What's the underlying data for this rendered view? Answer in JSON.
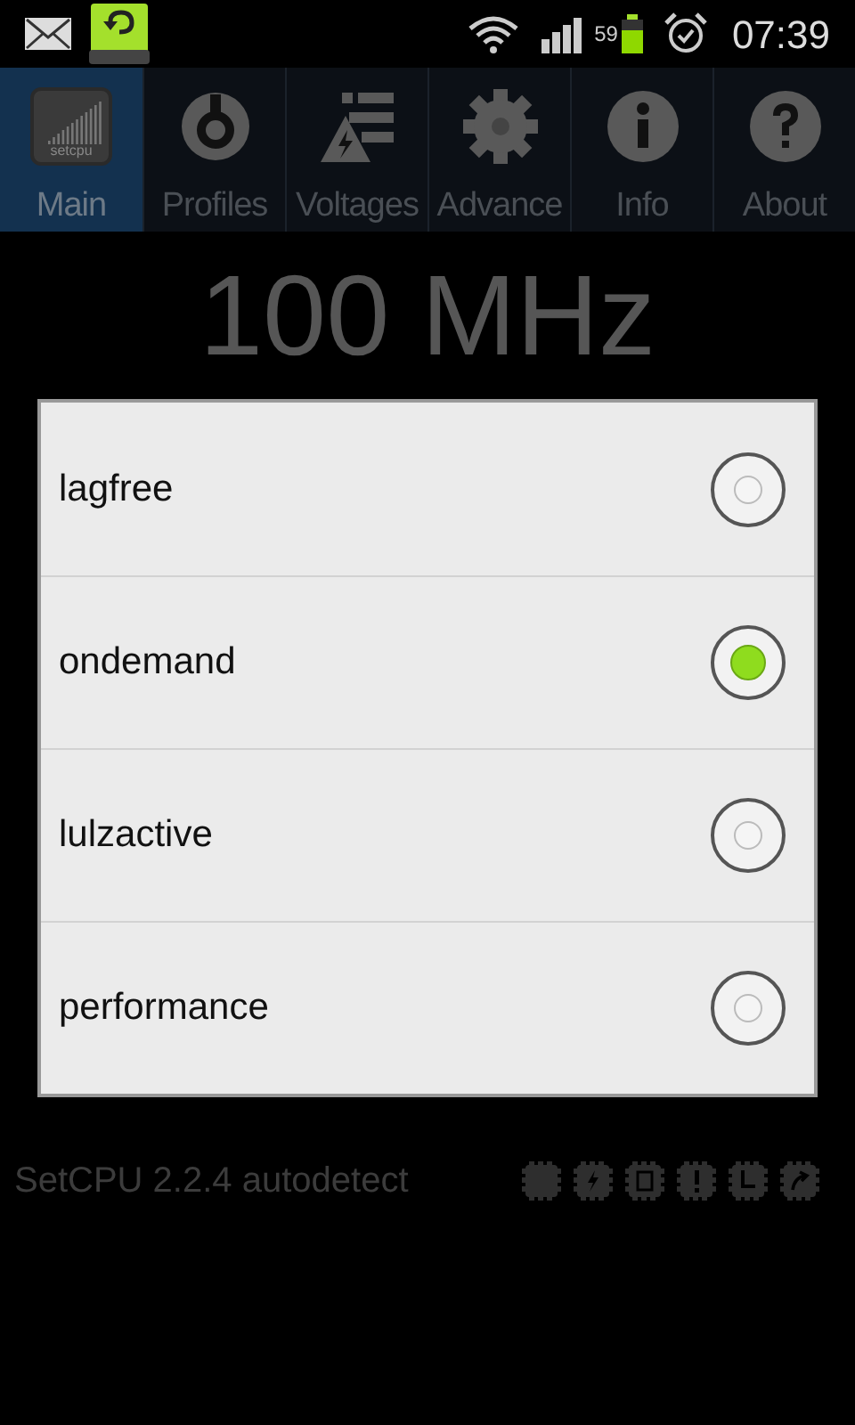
{
  "status_bar": {
    "battery_level_text": "59",
    "time": "07:39"
  },
  "tabs": [
    {
      "label": "Main",
      "kind": "logo",
      "logo_text": "setcpu",
      "selected": true
    },
    {
      "label": "Profiles",
      "kind": "profiles",
      "selected": false
    },
    {
      "label": "Voltages",
      "kind": "voltages",
      "selected": false
    },
    {
      "label": "Advance",
      "kind": "advance",
      "selected": false
    },
    {
      "label": "Info",
      "kind": "info",
      "selected": false
    },
    {
      "label": "About",
      "kind": "about",
      "selected": false
    }
  ],
  "frequency": "100 MHz",
  "governors": [
    {
      "label": "lagfree",
      "selected": false
    },
    {
      "label": "ondemand",
      "selected": true
    },
    {
      "label": "lulzactive",
      "selected": false
    },
    {
      "label": "performance",
      "selected": false
    }
  ],
  "footer": {
    "version": "SetCPU 2.2.4 autodetect"
  }
}
